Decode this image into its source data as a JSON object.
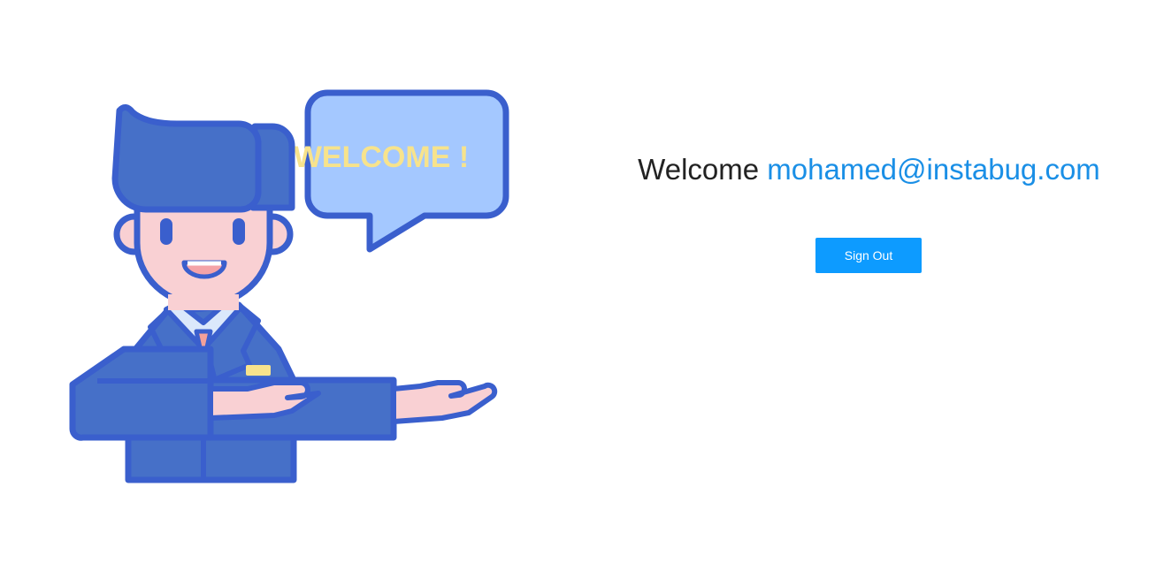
{
  "illustration": {
    "bubble_text": "WELCOME !",
    "icon": "welcoming-man-illustration"
  },
  "greeting": {
    "prefix": "Welcome",
    "email": "mohamed@instabug.com"
  },
  "actions": {
    "sign_out_label": "Sign Out"
  },
  "colors": {
    "accent": "#0d9bff",
    "email_link": "#1a8fe6",
    "outline": "#3a5fcd",
    "suit": "#4670c8",
    "skin": "#f9d0d3",
    "bubble_fill": "#a4c8ff",
    "bubble_text": "#f7e38c",
    "tie": "#f3a19a"
  }
}
